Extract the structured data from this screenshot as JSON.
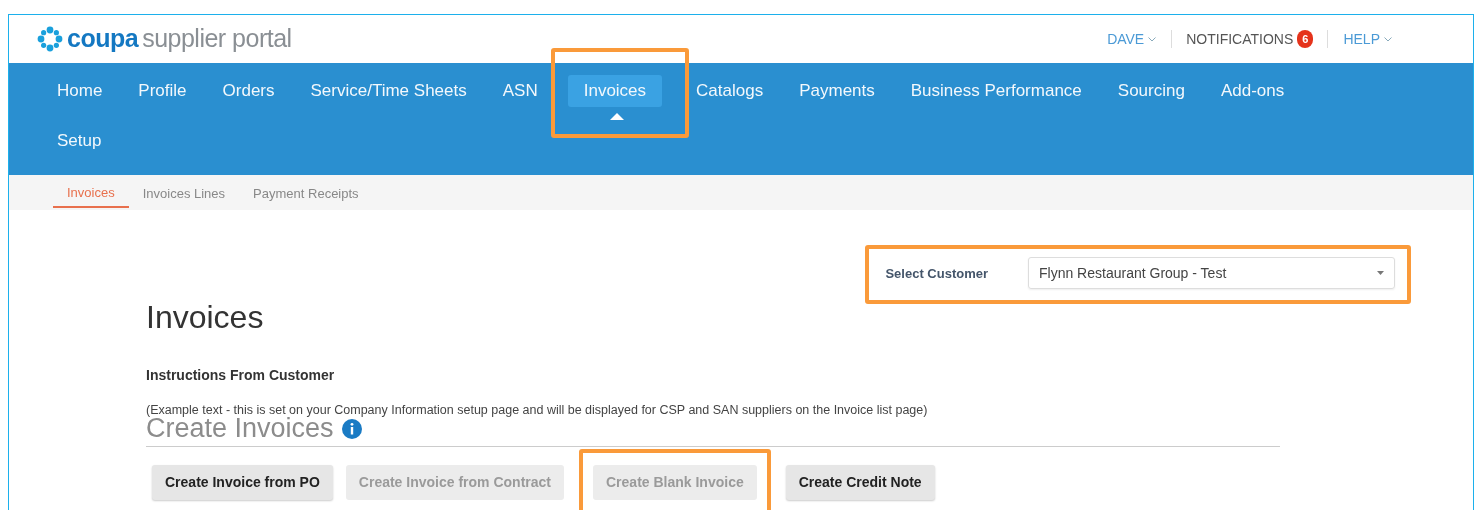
{
  "header": {
    "logo_word": "coupa",
    "logo_suffix": "supplier portal",
    "user_menu": "DAVE",
    "notifications": {
      "label": "NOTIFICATIONS",
      "count": "6"
    },
    "help_menu": "HELP"
  },
  "nav": [
    {
      "label": "Home",
      "selected": false,
      "highlighted": false
    },
    {
      "label": "Profile",
      "selected": false,
      "highlighted": false
    },
    {
      "label": "Orders",
      "selected": false,
      "highlighted": false
    },
    {
      "label": "Service/Time Sheets",
      "selected": false,
      "highlighted": false
    },
    {
      "label": "ASN",
      "selected": false,
      "highlighted": false
    },
    {
      "label": "Invoices",
      "selected": true,
      "highlighted": true
    },
    {
      "label": "Catalogs",
      "selected": false,
      "highlighted": false
    },
    {
      "label": "Payments",
      "selected": false,
      "highlighted": false
    },
    {
      "label": "Business Performance",
      "selected": false,
      "highlighted": false
    },
    {
      "label": "Sourcing",
      "selected": false,
      "highlighted": false
    },
    {
      "label": "Add-ons",
      "selected": false,
      "highlighted": false
    },
    {
      "label": "Setup",
      "selected": false,
      "highlighted": false
    }
  ],
  "subnav": [
    {
      "label": "Invoices",
      "selected": true
    },
    {
      "label": "Invoices Lines",
      "selected": false
    },
    {
      "label": "Payment Receipts",
      "selected": false
    }
  ],
  "customer_select": {
    "label": "Select Customer",
    "value": "Flynn Restaurant Group - Test",
    "highlighted": true
  },
  "page_title": "Invoices",
  "instructions": {
    "title": "Instructions From Customer",
    "text": "(Example text - this is set on your Company Information setup page and will be displayed for CSP and SAN suppliers on the Invoice list page)"
  },
  "create_section": {
    "title": "Create Invoices",
    "buttons": [
      {
        "label": "Create Invoice from PO",
        "disabled": false,
        "highlighted": false
      },
      {
        "label": "Create Invoice from Contract",
        "disabled": true,
        "highlighted": false
      },
      {
        "label": "Create Blank Invoice",
        "disabled": true,
        "highlighted": true
      },
      {
        "label": "Create Credit Note",
        "disabled": false,
        "highlighted": false
      }
    ]
  }
}
